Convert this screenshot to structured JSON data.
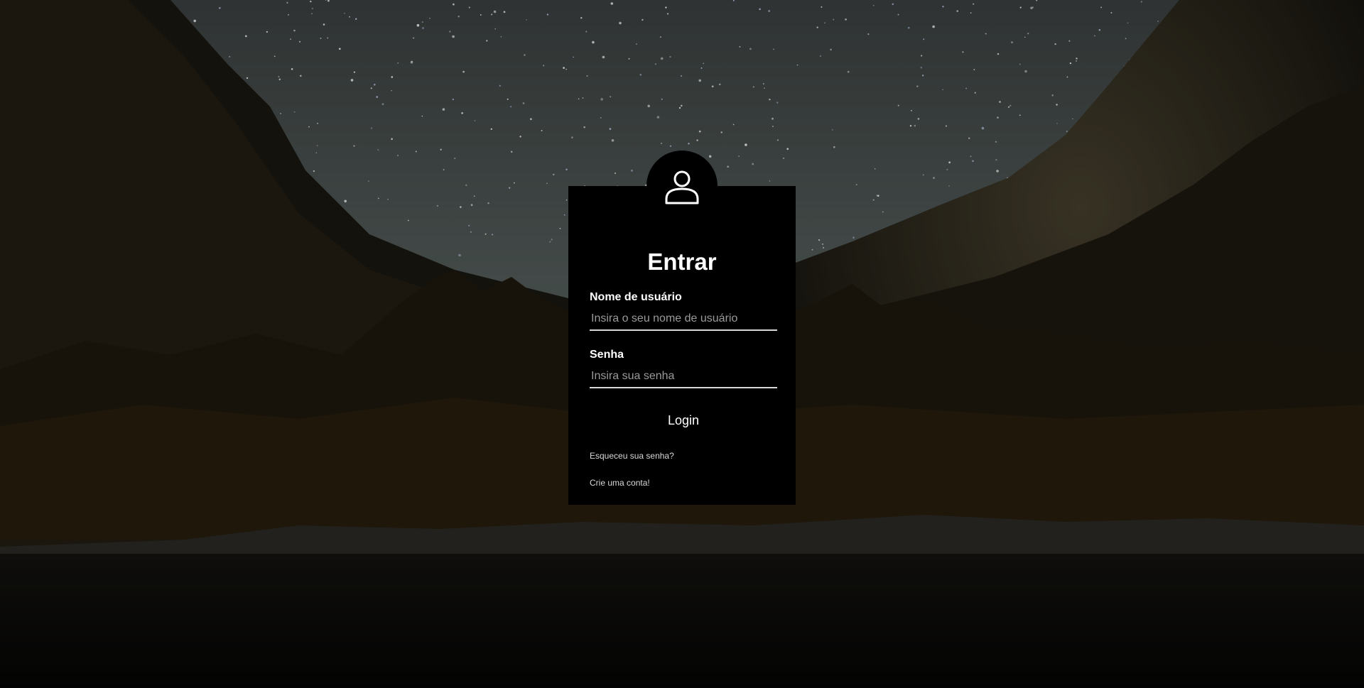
{
  "login": {
    "title": "Entrar",
    "username_label": "Nome de usuário",
    "username_placeholder": "Insira o seu nome de usuário",
    "username_value": "",
    "password_label": "Senha",
    "password_placeholder": "Insira sua senha",
    "password_value": "",
    "login_button": "Login",
    "forgot_password": "Esqueceu sua senha?",
    "create_account": "Crie uma conta!",
    "avatar_icon": "user-icon"
  },
  "colors": {
    "card_background": "#000000",
    "text": "#ffffff",
    "input_underline": "#d8d8d8",
    "placeholder": "#9a9a9a"
  }
}
